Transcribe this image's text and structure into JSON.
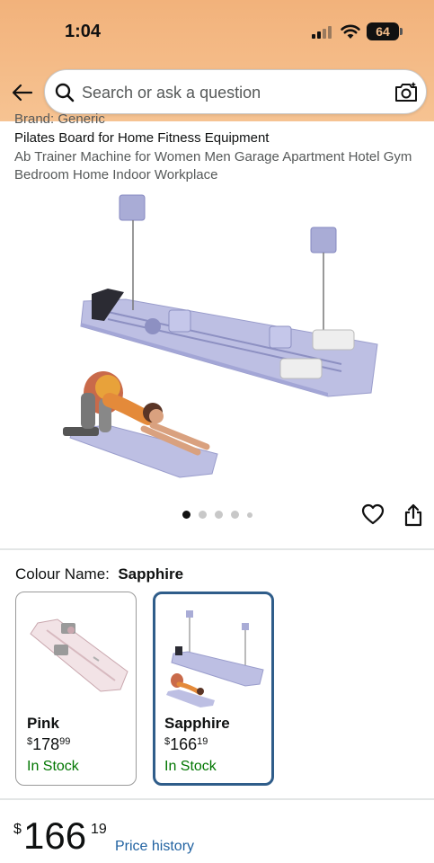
{
  "status_bar": {
    "time": "1:04",
    "battery": "64"
  },
  "search": {
    "placeholder": "Search or ask a question",
    "back_icon": "arrow-left-icon",
    "search_icon": "magnifier-icon",
    "camera_icon": "camera-lens-icon"
  },
  "product": {
    "brand": "Brand: Generic",
    "title_main": "Pilates Board for Home Fitness Equipment",
    "title_sub": "Ab Trainer Machine for Women Men Garage Apartment Hotel Gym Bedroom Home Indoor Workplace",
    "image_carousel": {
      "count": 5,
      "active_index": 0
    }
  },
  "colour": {
    "label": "Colour Name:",
    "selected": "Sapphire",
    "options": [
      {
        "name": "Pink",
        "currency": "$",
        "price_whole": "178",
        "price_fraction": "99",
        "stock": "In Stock"
      },
      {
        "name": "Sapphire",
        "currency": "$",
        "price_whole": "166",
        "price_fraction": "19",
        "stock": "In Stock"
      }
    ]
  },
  "price": {
    "currency": "$",
    "whole": "166",
    "fraction": "19",
    "history_link": "Price history"
  },
  "colors": {
    "header_bg": "#f4b983",
    "link": "#2162a1",
    "in_stock": "#007600",
    "selected_border": "#2f5d8a"
  }
}
